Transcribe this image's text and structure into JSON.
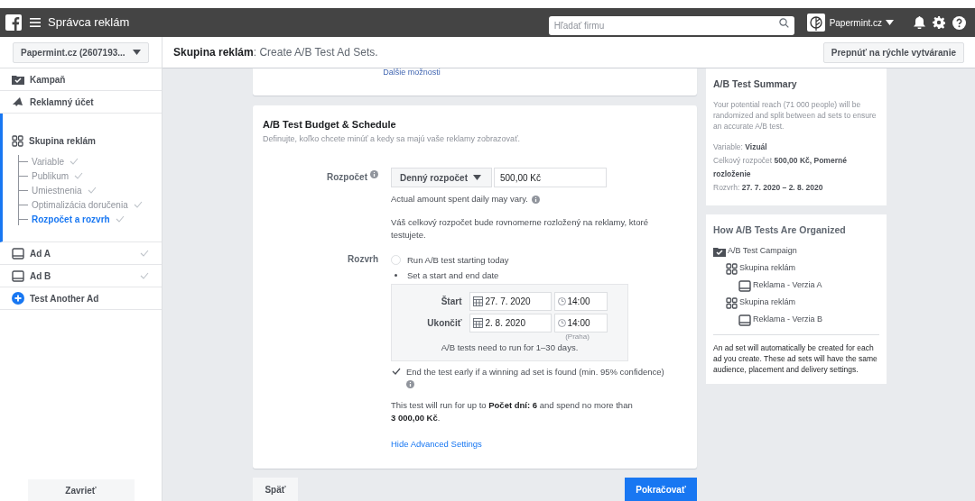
{
  "topbar": {
    "app_title": "Správca reklám",
    "search": {
      "placeholder": "Hľadať firmu"
    },
    "account": "Papermint.cz"
  },
  "header": {
    "account_selector": "Papermint.cz (2607193...",
    "title": "**Skupina reklám**: Create A/B Test Ad Sets.",
    "switch_button": "Prepnúť na rýchle vytváranie"
  },
  "sidebar": {
    "items": [
      {
        "kind": "campaign",
        "label": "Kampaň",
        "selected": false,
        "checked": false
      },
      {
        "kind": "account",
        "label": "Reklamný účet",
        "selected": false,
        "checked": false
      },
      {
        "kind": "adset",
        "label": "Skupina reklám",
        "selected": true,
        "checked": false,
        "children": [
          {
            "label": "Variable",
            "selected": false,
            "checked": true
          },
          {
            "label": "Publikum",
            "selected": false,
            "checked": true
          },
          {
            "label": "Umiestnenia",
            "selected": false,
            "checked": true
          },
          {
            "label": "Optimalizácia doručenia",
            "selected": false,
            "checked": true
          },
          {
            "label": "Rozpočet a rozvrh",
            "selected": true,
            "checked": true
          }
        ]
      },
      {
        "kind": "ad",
        "label": "Ad A",
        "selected": false,
        "checked": true
      },
      {
        "kind": "ad",
        "label": "Ad B",
        "selected": false,
        "checked": true
      },
      {
        "kind": "add",
        "label": "Test Another Ad",
        "selected": false,
        "checked": false
      }
    ],
    "close_button": "Zavrieť"
  },
  "main": {
    "partial_link": "Ďalšie možnosti",
    "budget_card": {
      "title": "A/B Test Budget & Schedule",
      "subtitle": "Definujte, koľko chcete minúť a kedy sa majú vaše reklamy zobrazovať.",
      "budget_label": "Rozpočet",
      "budget_type": "Denný rozpočet",
      "budget_value": "500,00 Kč",
      "note": "Actual amount spent daily may vary.",
      "distribution_note": "Váš celkový rozpočet bude rovnomerne rozložený na reklamy, ktoré testujete.",
      "schedule_label": "Rozvrh",
      "schedule_options": [
        {
          "label": "Run A/B test starting today",
          "selected": false
        },
        {
          "label": "Set a start and end date",
          "selected": true
        }
      ],
      "dates": [
        {
          "label": "Štart",
          "date": "27. 7. 2020",
          "time": "14:00"
        },
        {
          "label": "Ukončiť",
          "date": "2. 8. 2020",
          "time": "14:00"
        }
      ],
      "timezone": "(Praha)",
      "duration_note": "A/B tests need to run for 1–30 days.",
      "end_early": {
        "label": "End the test early if a winning ad set is found (min. 95% confidence)",
        "checked": true
      },
      "summary": "This test will run for up to **Počet dní: 6** and spend no more than **3 000,00 Kč**.",
      "advanced_link": "Hide Advanced Settings"
    },
    "back_button": "Späť",
    "continue_button": "Pokračovať"
  },
  "right": {
    "summary_card": {
      "title": "A/B Test Summary",
      "description": "Your potential reach (71 000 people) will be randomized and split between ad sets to ensure an accurate A/B test.",
      "details": [
        "Variable: **Vizuál**",
        "Celkový rozpočet **500,00 Kč, Pomerné rozloženie**",
        "Rozvrh: **27. 7. 2020 – 2. 8. 2020**"
      ]
    },
    "organization_card": {
      "title": "How A/B Tests Are Organized",
      "tree": [
        {
          "kind": "campaign",
          "label": "A/B Test Campaign",
          "children": [
            {
              "kind": "adset",
              "label": "Skupina reklám",
              "children": [
                {
                  "kind": "ad",
                  "label": "Reklama - Verzia A"
                }
              ]
            },
            {
              "kind": "adset",
              "label": "Skupina reklám",
              "children": [
                {
                  "kind": "ad",
                  "label": "Reklama - Verzia B"
                }
              ]
            }
          ]
        }
      ],
      "note": "An ad set will automatically be created for each ad you create. These ad sets will have the same audience, placement and delivery settings."
    }
  }
}
